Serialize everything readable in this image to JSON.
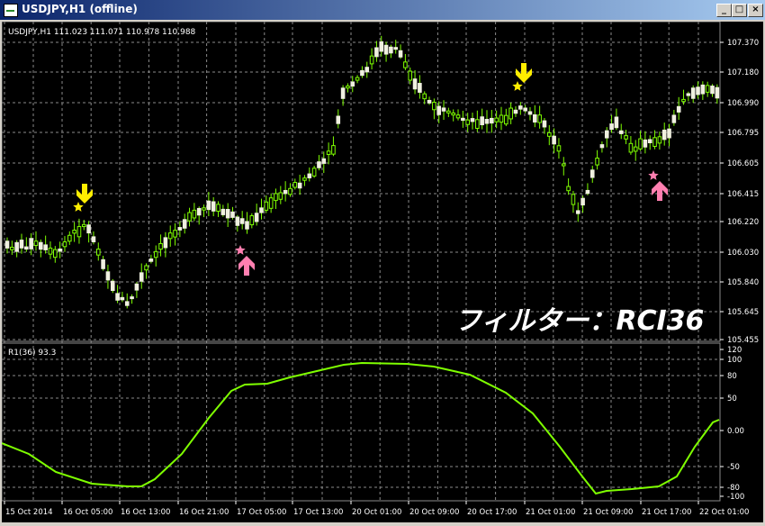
{
  "window": {
    "title": "USDJPY,H1 (offline)",
    "minimize_glyph": "_",
    "maximize_glyph": "□",
    "close_glyph": "×"
  },
  "main_chart": {
    "info_label": "USDJPY,H1  111.023 111.071 110.978 110.988",
    "price_ticks": [
      "107.370",
      "107.180",
      "106.990",
      "106.795",
      "106.605",
      "106.415",
      "106.220",
      "106.030",
      "105.840",
      "105.645",
      "105.455"
    ],
    "overlay_text": "フィルター：RCI36",
    "signals": [
      {
        "type": "sell",
        "x_index": 14
      },
      {
        "type": "buy",
        "x_index": 45
      },
      {
        "type": "sell",
        "x_index": 96
      },
      {
        "type": "buy",
        "x_index": 120
      }
    ]
  },
  "indicator": {
    "label": "R1(36) 93.3",
    "ticks": [
      "120",
      "100",
      "80",
      "50",
      "0.00",
      "-50",
      "-80",
      "-100"
    ]
  },
  "x_axis": {
    "labels": [
      "15 Oct 2014",
      "16 Oct 05:00",
      "16 Oct 13:00",
      "16 Oct 21:00",
      "17 Oct 05:00",
      "17 Oct 13:00",
      "20 Oct 01:00",
      "20 Oct 09:00",
      "20 Oct 17:00",
      "21 Oct 01:00",
      "21 Oct 09:00",
      "21 Oct 17:00",
      "22 Oct 01:00"
    ]
  },
  "chart_data": {
    "type": "candlestick",
    "symbol": "USDJPY",
    "timeframe": "H1",
    "ohlc": [],
    "indicator_series": []
  },
  "colors": {
    "background": "#000000",
    "grid": "#8a8a8a",
    "bull_candle": "#f0f0e0",
    "bear_candle": "#7fff00",
    "rci_line": "#7fff00",
    "sell_arrow": "#ffee00",
    "buy_arrow": "#ff7fb0"
  }
}
